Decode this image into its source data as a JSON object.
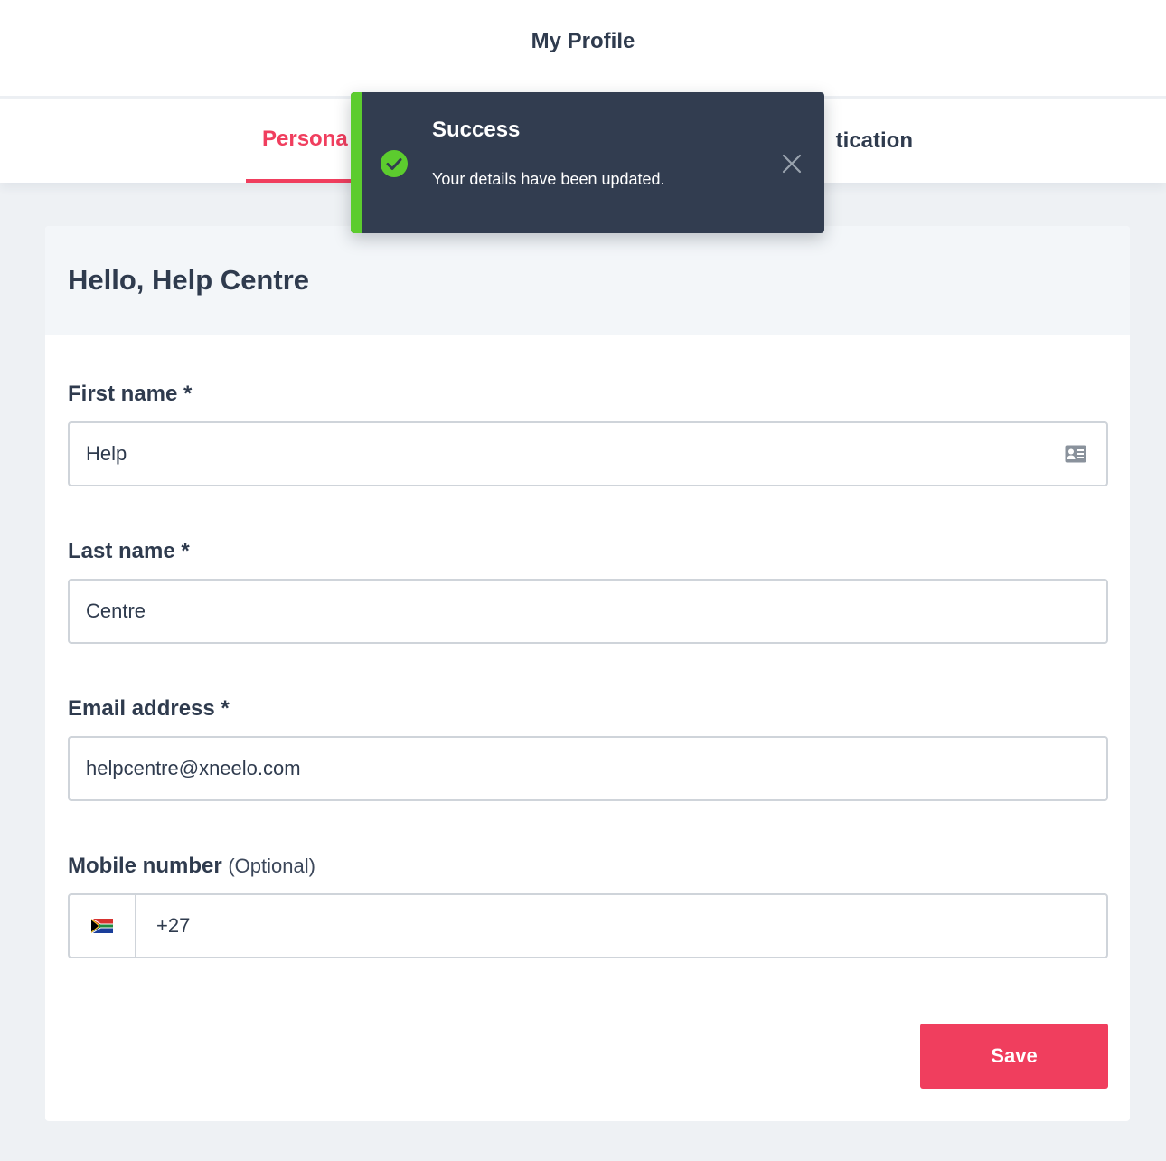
{
  "header": {
    "title": "My Profile"
  },
  "tabs": [
    {
      "label": "Persona",
      "active": true
    },
    {
      "label": "tication",
      "active": false
    }
  ],
  "card": {
    "greeting": "Hello, Help Centre"
  },
  "form": {
    "first_name": {
      "label": "First name *",
      "value": "Help",
      "icon": "contact-card-icon"
    },
    "last_name": {
      "label": "Last name *",
      "value": "Centre"
    },
    "email": {
      "label": "Email address *",
      "value": "helpcentre@xneelo.com"
    },
    "mobile": {
      "label": "Mobile number",
      "optional": "(Optional)",
      "value": "+27",
      "flag": "south-africa-flag-icon"
    },
    "save_label": "Save"
  },
  "toast": {
    "title": "Success",
    "message": "Your details have been updated.",
    "icon": "check-circle-icon",
    "accent_color": "#5ccc2e"
  },
  "colors": {
    "brand": "#f03e5e",
    "text": "#2f3b4e",
    "toast_bg": "#323d50"
  }
}
